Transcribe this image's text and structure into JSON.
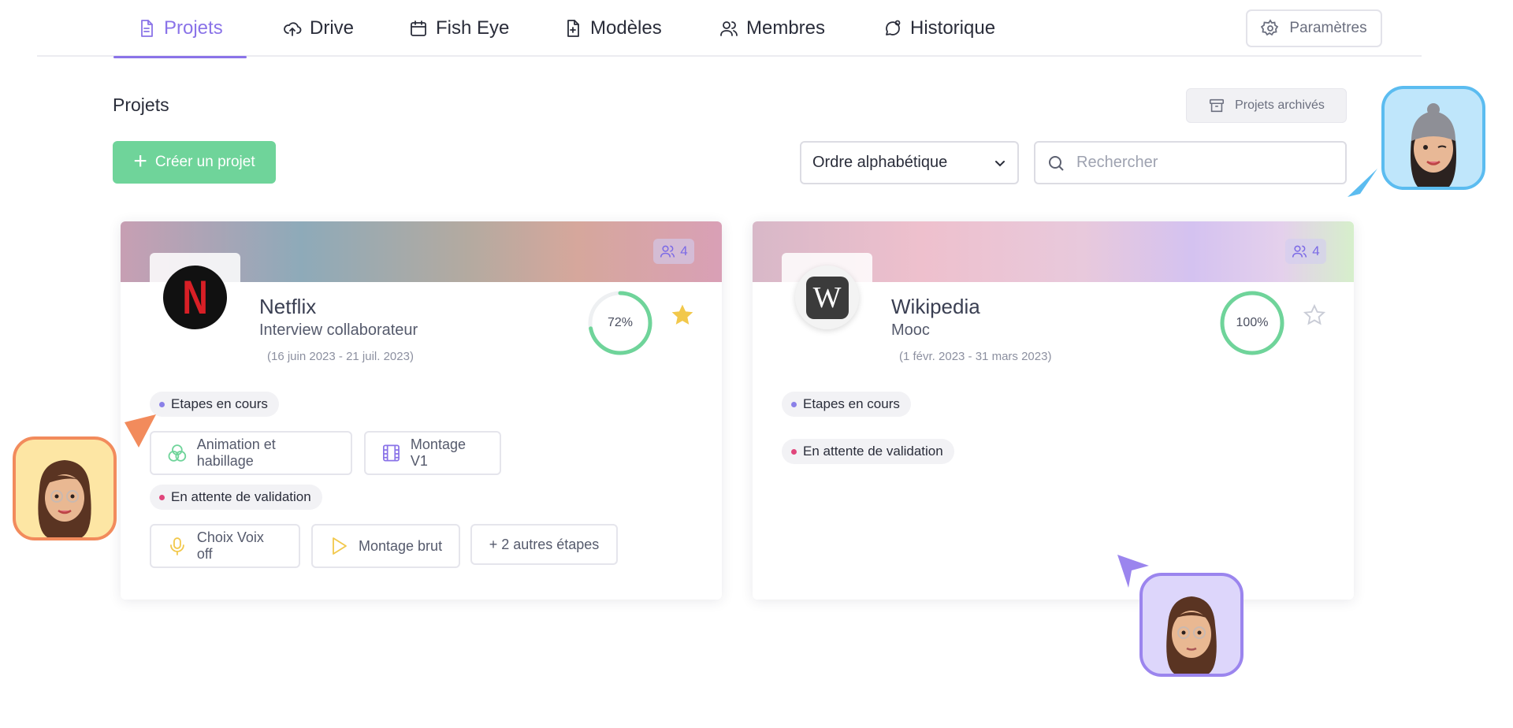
{
  "nav": {
    "tabs": [
      {
        "label": "Projets",
        "icon": "document-icon",
        "active": true
      },
      {
        "label": "Drive",
        "icon": "cloud-upload-icon"
      },
      {
        "label": "Fish Eye",
        "icon": "calendar-icon"
      },
      {
        "label": "Modèles",
        "icon": "file-plus-icon"
      },
      {
        "label": "Membres",
        "icon": "users-icon"
      },
      {
        "label": "Historique",
        "icon": "chat-history-icon"
      }
    ],
    "settings_label": "Paramètres"
  },
  "header": {
    "title": "Projets",
    "archived_label": "Projets archivés",
    "create_label": "Créer un projet",
    "sort_value": "Ordre alphabétique",
    "search_placeholder": "Rechercher"
  },
  "projects": [
    {
      "name": "Netflix",
      "subtitle": "Interview collaborateur",
      "dates": "(16 juin 2023 - 21 juil. 2023)",
      "members": "4",
      "progress_label": "72%",
      "progress": 0.72,
      "starred": true,
      "statuses": [
        {
          "label": "Etapes en cours",
          "color": "#8a80e8",
          "steps": [
            {
              "label": "Animation et habillage",
              "icon": "circles-icon",
              "color": "#6fd49a"
            },
            {
              "label": "Montage V1",
              "icon": "film-icon",
              "color": "#8a73e8"
            }
          ]
        },
        {
          "label": "En attente de validation",
          "color": "#e0457b",
          "steps": [
            {
              "label": "Choix Voix off",
              "icon": "microphone-icon",
              "color": "#f2c84b"
            },
            {
              "label": "Montage brut",
              "icon": "play-icon",
              "color": "#f2c84b"
            },
            {
              "label": "+ 2 autres étapes",
              "icon": "",
              "color": ""
            }
          ]
        }
      ]
    },
    {
      "name": "Wikipedia",
      "subtitle": "Mooc",
      "dates": "(1 févr. 2023 - 31 mars 2023)",
      "members": "4",
      "progress_label": "100%",
      "progress": 1.0,
      "starred": false,
      "statuses": [
        {
          "label": "Etapes en cours",
          "color": "#8a80e8",
          "steps": []
        },
        {
          "label": "En attente de validation",
          "color": "#e0457b",
          "steps": []
        }
      ]
    }
  ],
  "collaborators": [
    {
      "name": "avatar-blue",
      "bg": "#bfe6fb",
      "border": "#5bbcf0",
      "cursor_color": "#5bbcf0"
    },
    {
      "name": "avatar-orange",
      "bg": "#fde6a4",
      "border": "#f28b5c",
      "cursor_color": "#f28b5c"
    },
    {
      "name": "avatar-purple",
      "bg": "#ddd6fb",
      "border": "#9b85ee",
      "cursor_color": "#9b85ee"
    }
  ],
  "colors": {
    "accent": "#8a73e8",
    "success": "#6fd49a",
    "star": "#f2c84b"
  }
}
